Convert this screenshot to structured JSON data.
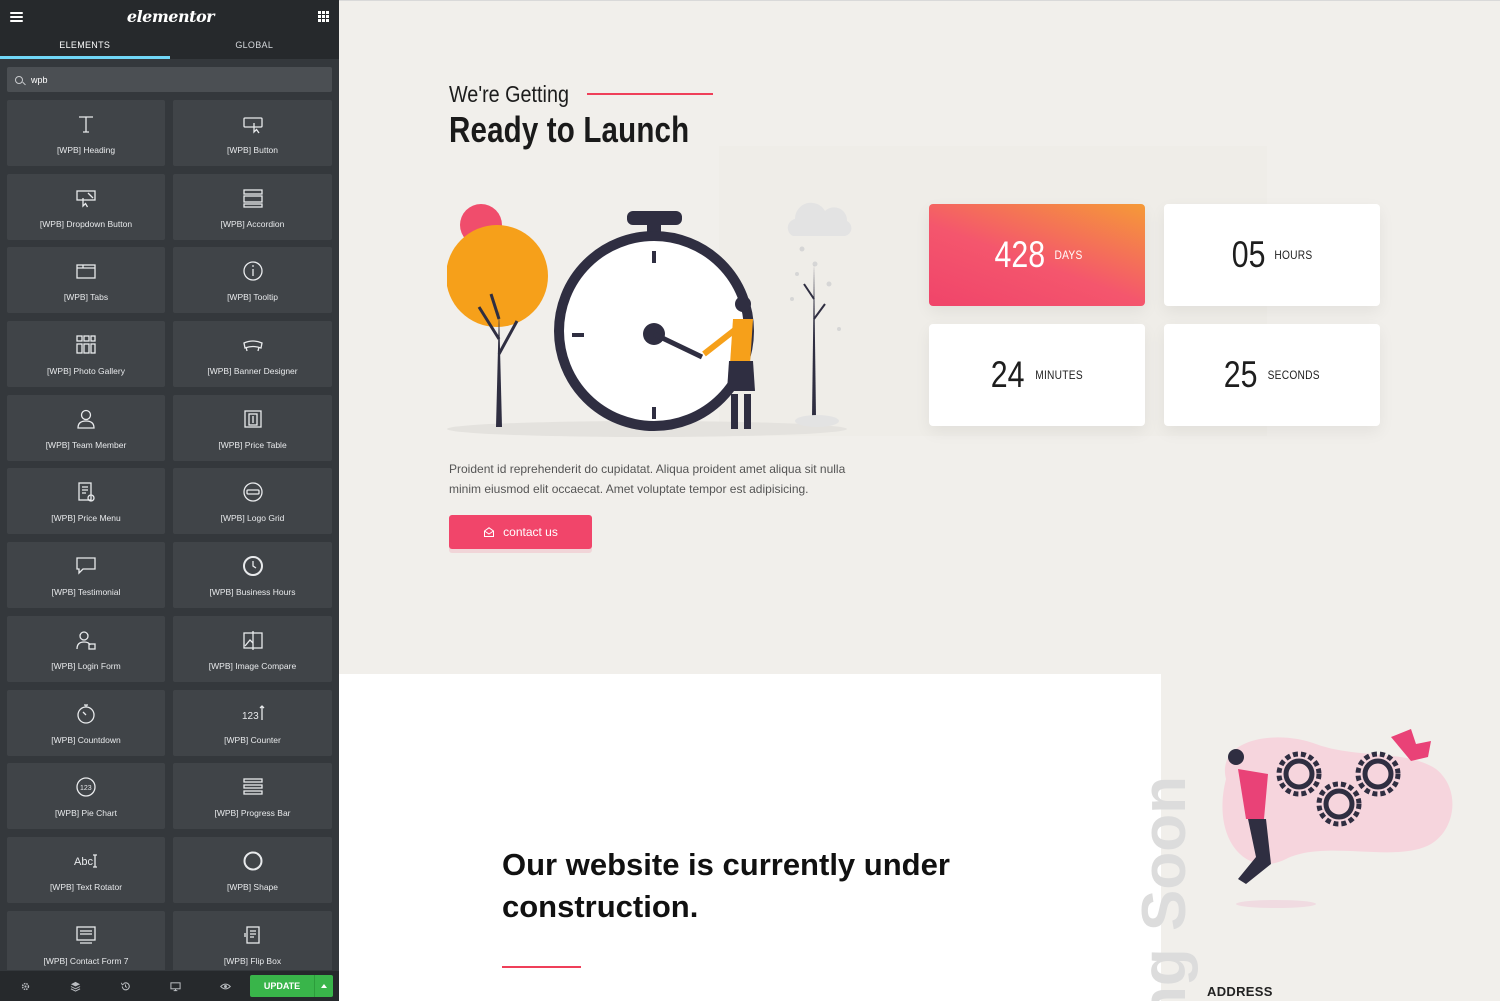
{
  "app": {
    "logo": "elementor",
    "tabs": [
      "ELEMENTS",
      "GLOBAL"
    ],
    "search": {
      "value": "wpb"
    },
    "widgets": [
      {
        "label": "[WPB] Heading",
        "icon": "heading-icon"
      },
      {
        "label": "[WPB] Button",
        "icon": "button-icon"
      },
      {
        "label": "[WPB] Dropdown Button",
        "icon": "dropdown-button-icon"
      },
      {
        "label": "[WPB] Accordion",
        "icon": "accordion-icon"
      },
      {
        "label": "[WPB] Tabs",
        "icon": "tabs-icon"
      },
      {
        "label": "[WPB] Tooltip",
        "icon": "tooltip-icon"
      },
      {
        "label": "[WPB] Photo Gallery",
        "icon": "gallery-icon"
      },
      {
        "label": "[WPB] Banner Designer",
        "icon": "banner-icon"
      },
      {
        "label": "[WPB] Team Member",
        "icon": "team-member-icon"
      },
      {
        "label": "[WPB] Price Table",
        "icon": "price-table-icon"
      },
      {
        "label": "[WPB] Price Menu",
        "icon": "price-menu-icon"
      },
      {
        "label": "[WPB] Logo Grid",
        "icon": "logo-grid-icon"
      },
      {
        "label": "[WPB] Testimonial",
        "icon": "testimonial-icon"
      },
      {
        "label": "[WPB] Business Hours",
        "icon": "clock-icon"
      },
      {
        "label": "[WPB] Login Form",
        "icon": "login-form-icon"
      },
      {
        "label": "[WPB] Image Compare",
        "icon": "image-compare-icon"
      },
      {
        "label": "[WPB] Countdown",
        "icon": "countdown-icon"
      },
      {
        "label": "[WPB] Counter",
        "icon": "counter-icon"
      },
      {
        "label": "[WPB] Pie Chart",
        "icon": "pie-chart-icon"
      },
      {
        "label": "[WPB] Progress Bar",
        "icon": "progress-bar-icon"
      },
      {
        "label": "[WPB] Text Rotator",
        "icon": "text-rotator-icon"
      },
      {
        "label": "[WPB] Shape",
        "icon": "shape-icon"
      },
      {
        "label": "[WPB] Contact Form 7",
        "icon": "contact-form-icon"
      },
      {
        "label": "[WPB] Flip Box",
        "icon": "flip-box-icon"
      }
    ],
    "footer": {
      "update_label": "UPDATE"
    },
    "colors": {
      "panel": "#34383c",
      "panel_dark": "#26292c",
      "tab_accent": "#71d7f7",
      "update": "#39b54a"
    }
  },
  "preview": {
    "pre_title": "We're Getting",
    "title": "Ready to Launch",
    "countdown": [
      {
        "value": "428",
        "unit": "DAYS"
      },
      {
        "value": "05",
        "unit": "HOURS"
      },
      {
        "value": "24",
        "unit": "MINUTES"
      },
      {
        "value": "25",
        "unit": "SECONDS"
      }
    ],
    "text": "Proident id reprehenderit do cupidatat. Aliqua proident amet aliqua sit nulla minim eiusmod elit occaecat. Amet voluptate tempor est adipisicing.",
    "contact_label": "contact us",
    "vertical_text": "ng Soon",
    "section2_title": "Our website is currently under construction.",
    "address_label": "ADDRESS",
    "colors": {
      "accent": "#f1456a",
      "gradient_start": "#f59a37",
      "bg": "#f1efeb"
    }
  }
}
